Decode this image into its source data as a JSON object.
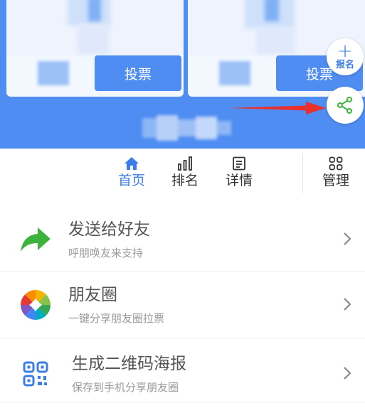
{
  "cards": [
    {
      "vote_label": "投票"
    },
    {
      "vote_label": "投票"
    }
  ],
  "floating": {
    "signup_label": "报名",
    "signup_icon": "plus-icon",
    "share_icon": "share-icon"
  },
  "tabs": [
    {
      "label": "首页",
      "icon": "home-icon",
      "active": true
    },
    {
      "label": "排名",
      "icon": "bar-chart-icon",
      "active": false
    },
    {
      "label": "详情",
      "icon": "document-icon",
      "active": false
    },
    {
      "label": "管理",
      "icon": "grid-icon",
      "active": false
    }
  ],
  "share_options": [
    {
      "title": "发送给好友",
      "subtitle": "呼朋唤友来支持",
      "icon": "forward-arrow-icon"
    },
    {
      "title": "朋友圈",
      "subtitle": "一键分享朋友圈拉票",
      "icon": "moments-aperture-icon"
    },
    {
      "title": "生成二维码海报",
      "subtitle": "保存到手机分享朋友圈",
      "icon": "qr-code-icon"
    }
  ],
  "colors": {
    "primary": "#4f8df2",
    "accent_blue": "#3a7de8",
    "share_green": "#3cb43c",
    "arrow_red": "#e8312c"
  }
}
